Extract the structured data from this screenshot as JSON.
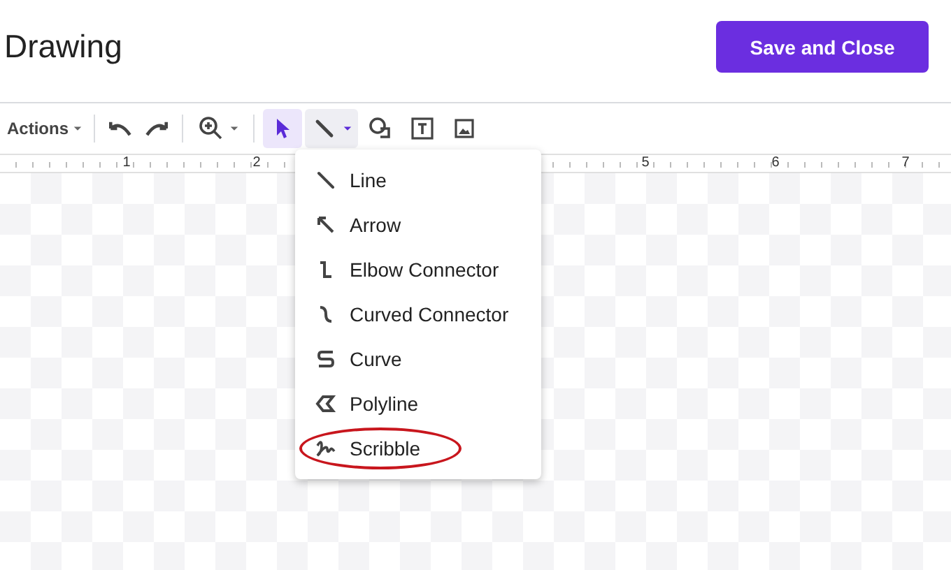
{
  "header": {
    "title": "Drawing",
    "save_button": "Save and Close"
  },
  "toolbar": {
    "actions_menu": "Actions",
    "tools": [
      {
        "kind": "undo",
        "selected": false
      },
      {
        "kind": "redo",
        "selected": false
      },
      {
        "kind": "zoom",
        "selected": false
      },
      {
        "kind": "select",
        "selected": true
      },
      {
        "kind": "line",
        "selected": false,
        "expanded": true
      },
      {
        "kind": "shape",
        "selected": false
      },
      {
        "kind": "textbox",
        "selected": false
      },
      {
        "kind": "image",
        "selected": false
      }
    ]
  },
  "ruler": {
    "left_numbers": [
      "1",
      "2"
    ],
    "right_numbers": [
      "5",
      "6",
      "7"
    ]
  },
  "line_menu": {
    "items": [
      {
        "kind": "line",
        "label": "Line",
        "circled": false
      },
      {
        "kind": "arrow",
        "label": "Arrow",
        "circled": false
      },
      {
        "kind": "elbow",
        "label": "Elbow Connector",
        "circled": false
      },
      {
        "kind": "curved",
        "label": "Curved Connector",
        "circled": false
      },
      {
        "kind": "curve",
        "label": "Curve",
        "circled": false
      },
      {
        "kind": "polyline",
        "label": "Polyline",
        "circled": false
      },
      {
        "kind": "scribble",
        "label": "Scribble",
        "circled": true
      }
    ]
  }
}
